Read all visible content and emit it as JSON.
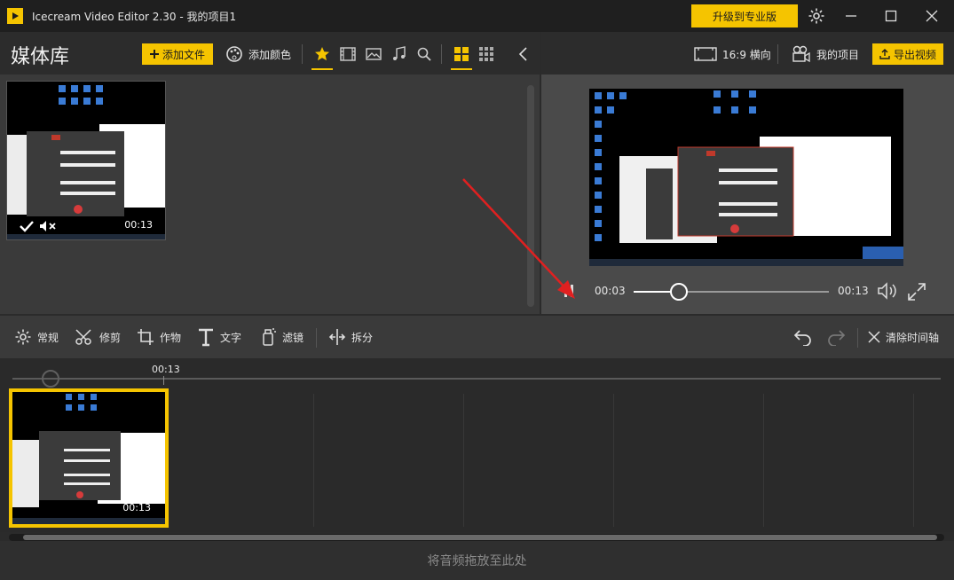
{
  "titlebar": {
    "app_name": "Icecream Video Editor 2.30",
    "project_name": "我的项目1",
    "upgrade_label": "升级到专业版"
  },
  "library": {
    "title": "媒体库",
    "add_file_label": "添加文件",
    "add_color_label": "添加颜色",
    "media_items": [
      {
        "duration": "00:13"
      }
    ]
  },
  "preview": {
    "aspect_label": "16:9 横向",
    "my_projects_label": "我的项目",
    "export_label": "导出视频",
    "current_time": "00:03",
    "total_time": "00:13",
    "progress": 0.23
  },
  "edit_toolbar": {
    "general_label": "常规",
    "trim_label": "修剪",
    "crop_label": "作物",
    "text_label": "文字",
    "filter_label": "滤镜",
    "split_label": "拆分",
    "clear_label": "清除时间轴"
  },
  "timeline": {
    "marker_time": "00:13",
    "clip_duration": "00:13"
  },
  "audio_zone": {
    "hint": "将音频拖放至此处"
  },
  "colors": {
    "accent": "#f5c400",
    "arrow": "#e02020"
  }
}
